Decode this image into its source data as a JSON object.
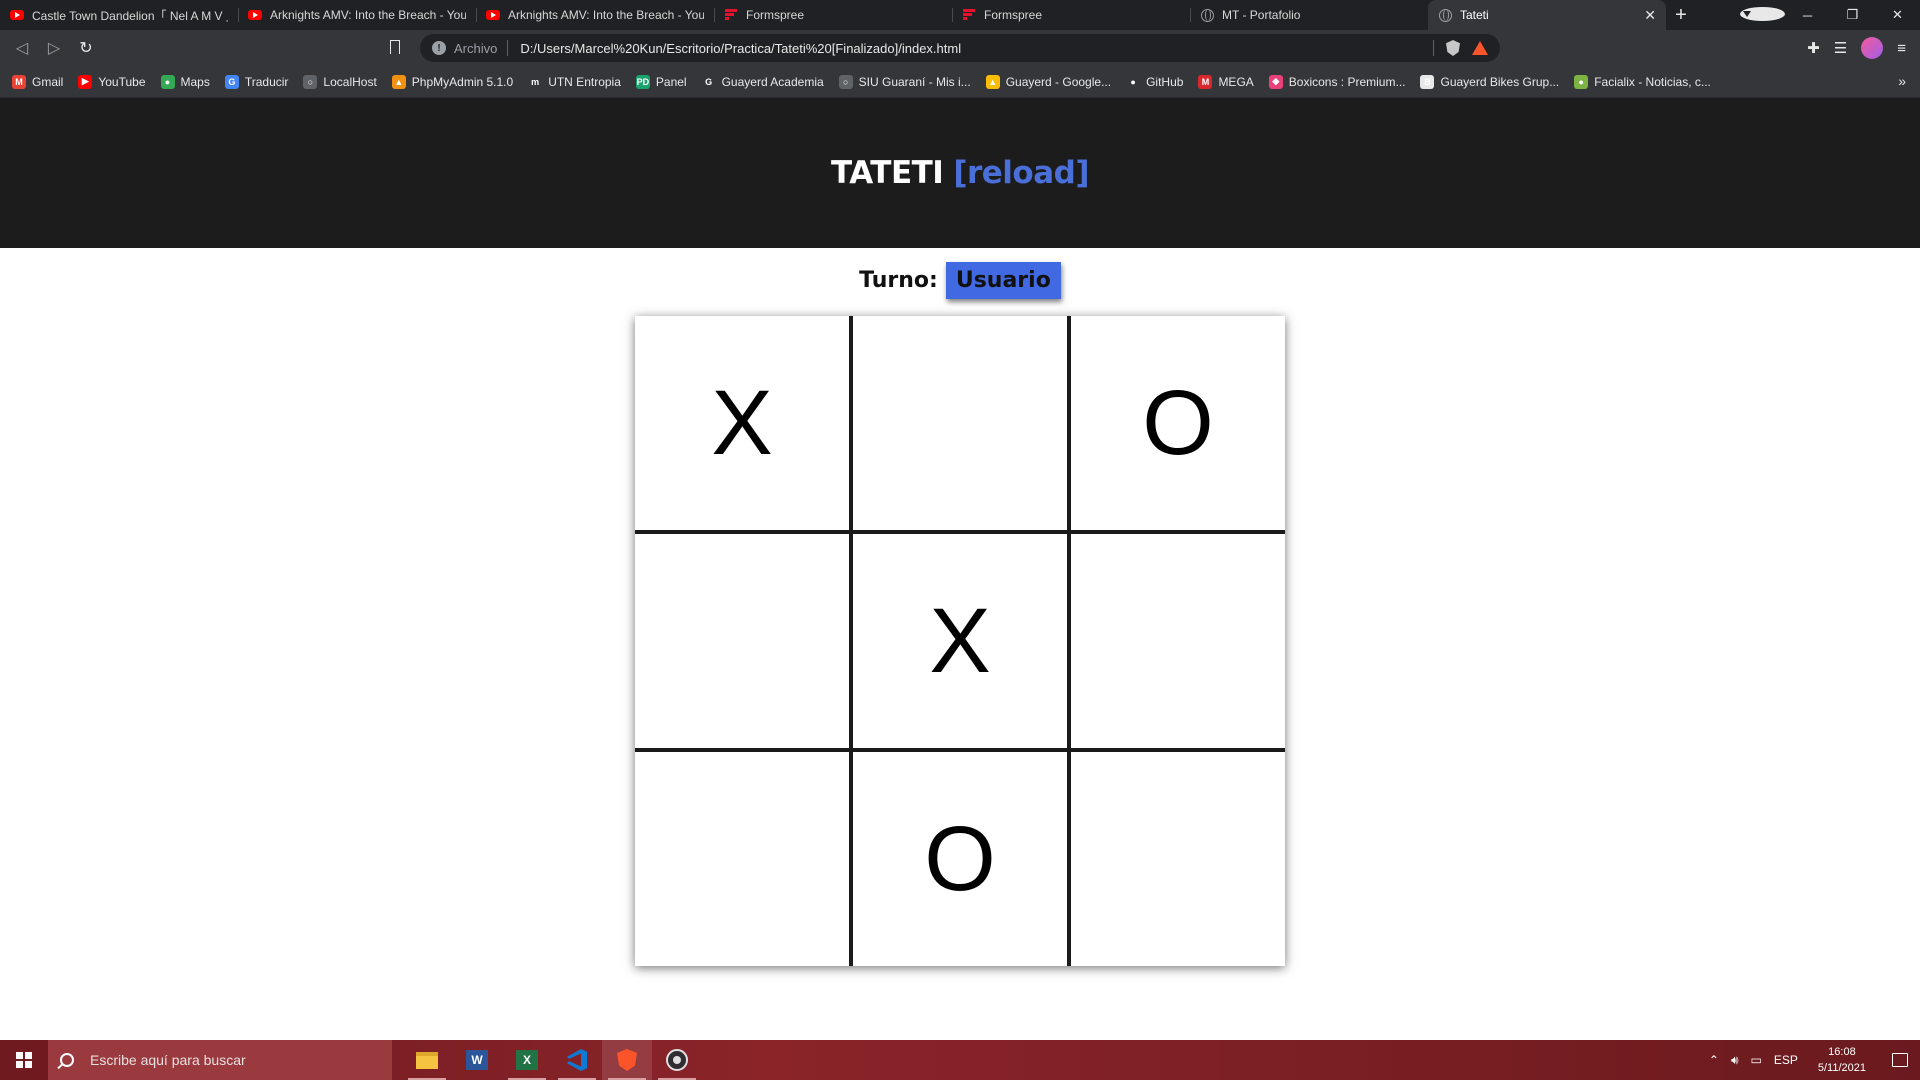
{
  "browser": {
    "tabs": [
      {
        "title": "Castle Town Dandelion「 Nel A M V 」-",
        "icon": "youtube-icon"
      },
      {
        "title": "Arknights AMV: Into the Breach - You",
        "icon": "youtube-icon"
      },
      {
        "title": "Arknights AMV: Into the Breach - You",
        "icon": "youtube-icon"
      },
      {
        "title": "Formspree",
        "icon": "formspree-icon"
      },
      {
        "title": "Formspree",
        "icon": "formspree-icon"
      },
      {
        "title": "MT - Portafolio",
        "icon": "globe-icon"
      },
      {
        "title": "Tateti",
        "icon": "globe-icon",
        "active": true
      }
    ],
    "omnibox": {
      "security_label": "Archivo",
      "url": "D:/Users/Marcel%20Kun/Escritorio/Practica/Tateti%20[Finalizado]/index.html"
    },
    "bookmarks": [
      {
        "label": "Gmail",
        "icon": "gmail-icon",
        "color": "#ea4335",
        "glyph": "M"
      },
      {
        "label": "YouTube",
        "icon": "youtube-icon",
        "color": "#ff0000",
        "glyph": "▶"
      },
      {
        "label": "Maps",
        "icon": "maps-icon",
        "color": "#34a853",
        "glyph": "●"
      },
      {
        "label": "Traducir",
        "icon": "translate-icon",
        "color": "#4285f4",
        "glyph": "G"
      },
      {
        "label": "LocalHost",
        "icon": "globe-icon",
        "color": "#5f6368",
        "glyph": "○"
      },
      {
        "label": "PhpMyAdmin 5.1.0",
        "icon": "phpmyadmin-icon",
        "color": "#f29111",
        "glyph": "▲"
      },
      {
        "label": "UTN Entropia",
        "icon": "utn-icon",
        "color": "#35363a",
        "glyph": "m"
      },
      {
        "label": "Panel",
        "icon": "panel-icon",
        "color": "#1aa36b",
        "glyph": "PD"
      },
      {
        "label": "Guayerd Academia",
        "icon": "google-icon",
        "color": "#35363a",
        "glyph": "G"
      },
      {
        "label": "SIU Guaraní - Mis i...",
        "icon": "globe-icon",
        "color": "#5f6368",
        "glyph": "○"
      },
      {
        "label": "Guayerd - Google...",
        "icon": "drive-icon",
        "color": "#fbbc04",
        "glyph": "▲"
      },
      {
        "label": "GitHub",
        "icon": "github-icon",
        "color": "#35363a",
        "glyph": "●"
      },
      {
        "label": "MEGA",
        "icon": "mega-icon",
        "color": "#d9272e",
        "glyph": "M"
      },
      {
        "label": "Boxicons : Premium...",
        "icon": "boxicons-icon",
        "color": "#e8417a",
        "glyph": "◆"
      },
      {
        "label": "Guayerd Bikes Grup...",
        "icon": "bikes-icon",
        "color": "#e8e8e8",
        "glyph": "B"
      },
      {
        "label": "Facialix - Noticias, c...",
        "icon": "facialix-icon",
        "color": "#7cb342",
        "glyph": "●"
      }
    ]
  },
  "page": {
    "title": "TATETI",
    "reload_label": "[reload]",
    "turn_label": "Turno:",
    "turn_value": "Usuario"
  },
  "board": {
    "cells": [
      "X",
      "",
      "O",
      "",
      "X",
      "",
      "",
      "O",
      ""
    ]
  },
  "taskbar": {
    "search_placeholder": "Escribe aquí para buscar",
    "language": "ESP",
    "time": "16:08",
    "date": "5/11/2021"
  },
  "colors": {
    "header_bg": "#1c1c1c",
    "reload_link": "#4a6fd8",
    "turn_badge": "#4169e1"
  }
}
